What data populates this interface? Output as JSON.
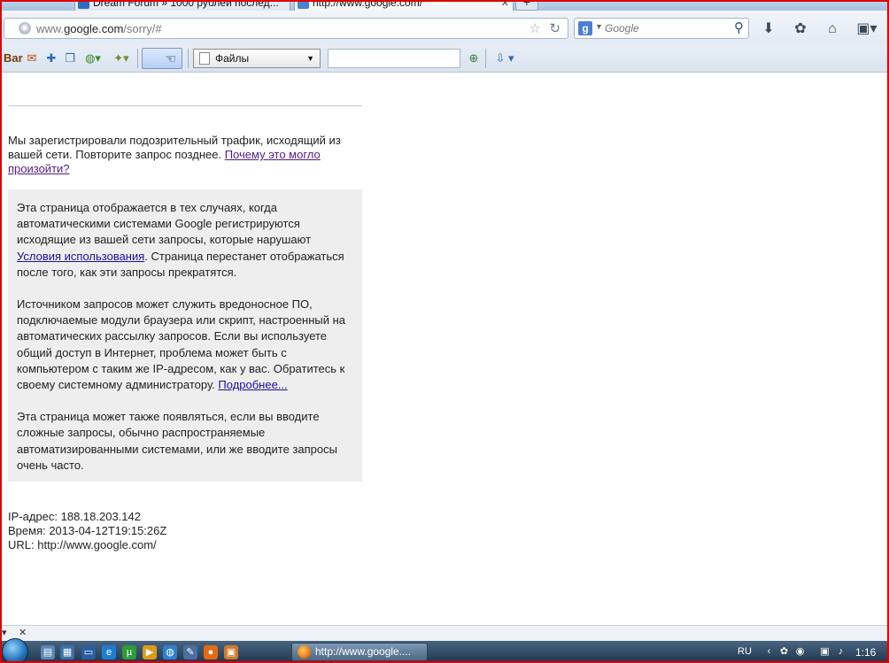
{
  "browser": {
    "tabs": [
      {
        "label": "Dream Forum » 1000 рублей послед..."
      },
      {
        "label": "http://www.google.com/"
      }
    ],
    "new_tab_icon": "plus-icon",
    "url_prefix": "www.",
    "url_domain": "google.com",
    "url_path": "/sorry/#",
    "search_placeholder": "Google",
    "search_engine_icon": "google-icon"
  },
  "toolbar": {
    "bar_label": "Bar",
    "files_label": "Файлы",
    "search_value": ""
  },
  "page": {
    "lead_text": "Мы зарегистрировали подозрительный трафик, исходящий из вашей сети. Повторите запрос позднее.",
    "lead_link": "Почему это могло произойти?",
    "box_p1_text": "Эта страница отображается в тех случаях, когда автоматическими системами Google регистрируются исходящие из вашей сети запросы, которые нарушают",
    "box_p1_link": "Условия использования",
    "box_p1_text2": ". Страница перестанет отображаться после того, как эти запросы прекратятся.",
    "box_p2_text": "Источником запросов может служить вредоносное ПО, подключаемые модули браузера или скрипт, настроенный на автоматических рассылку запросов. Если вы используете общий доступ в Интернет, проблема может быть с компьютером с таким же IP-адресом, как у вас. Обратитесь к своему системному администратору.",
    "box_p2_link": "Подробнее...",
    "box_p3_text": "Эта страница может также появляться, если вы вводите сложные запросы, обычно распространяемые автоматизированными системами, или же вводите запросы очень часто.",
    "ip_line": "IP-адрес: 188.18.203.142",
    "time_line": "Время: 2013-04-12T19:15:26Z",
    "url_line": "URL: http://www.google.com/"
  },
  "taskbar": {
    "window_label": "http://www.google....",
    "lang": "RU",
    "clock": "1:16"
  },
  "colors": {
    "frame_border": "#e00000",
    "link_visited": "#551a8b",
    "link": "#1a0dab",
    "box_bg": "#eeeeee"
  }
}
